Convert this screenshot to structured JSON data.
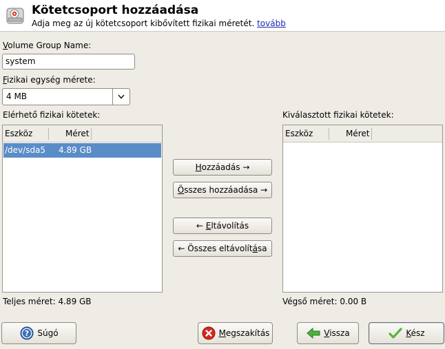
{
  "header": {
    "title": "Kötetcsoport hozzáadása",
    "subtitle": "Adja meg az új kötetcsoport kibővített fizikai méretét.",
    "link": "tovább"
  },
  "vg_name": {
    "label_first": "V",
    "label_rest": "olume Group Name:",
    "value": "system"
  },
  "pe_size": {
    "label_first": "F",
    "label_rest": "izikai egység mérete:",
    "value": "4 MB"
  },
  "available": {
    "label": "Elérhető fizikai kötetek:",
    "columns": [
      "Eszköz",
      "Méret"
    ],
    "rows": [
      {
        "device": "/dev/sda5",
        "size": "4.89 GB",
        "selected": true
      }
    ],
    "total": "Teljes méret: 4.89 GB"
  },
  "selected": {
    "label": "Kiválasztott fizikai kötetek:",
    "columns": [
      "Eszköz",
      "Méret"
    ],
    "rows": [],
    "total": "Végső méret: 0.00 B"
  },
  "transfer": {
    "add": {
      "m": "H",
      "rest": "ozzáadás →"
    },
    "add_all": {
      "m": "Ö",
      "rest": "sszes hozzáadása →"
    },
    "remove": {
      "pre": "← ",
      "m": "E",
      "rest": "ltávolítás"
    },
    "remove_all": {
      "pre": "← Összes eltávolít",
      "m": "á",
      "rest": "sa"
    }
  },
  "footer": {
    "help": "Súgó",
    "cancel": {
      "m": "M",
      "rest": "egszakítás"
    },
    "back": {
      "m": "V",
      "rest": "issza"
    },
    "finish": {
      "m": "K",
      "rest": "ész"
    }
  },
  "colors": {
    "selection": "#5a8cc8",
    "link": "#1a2ab4",
    "background": "#efece6"
  }
}
